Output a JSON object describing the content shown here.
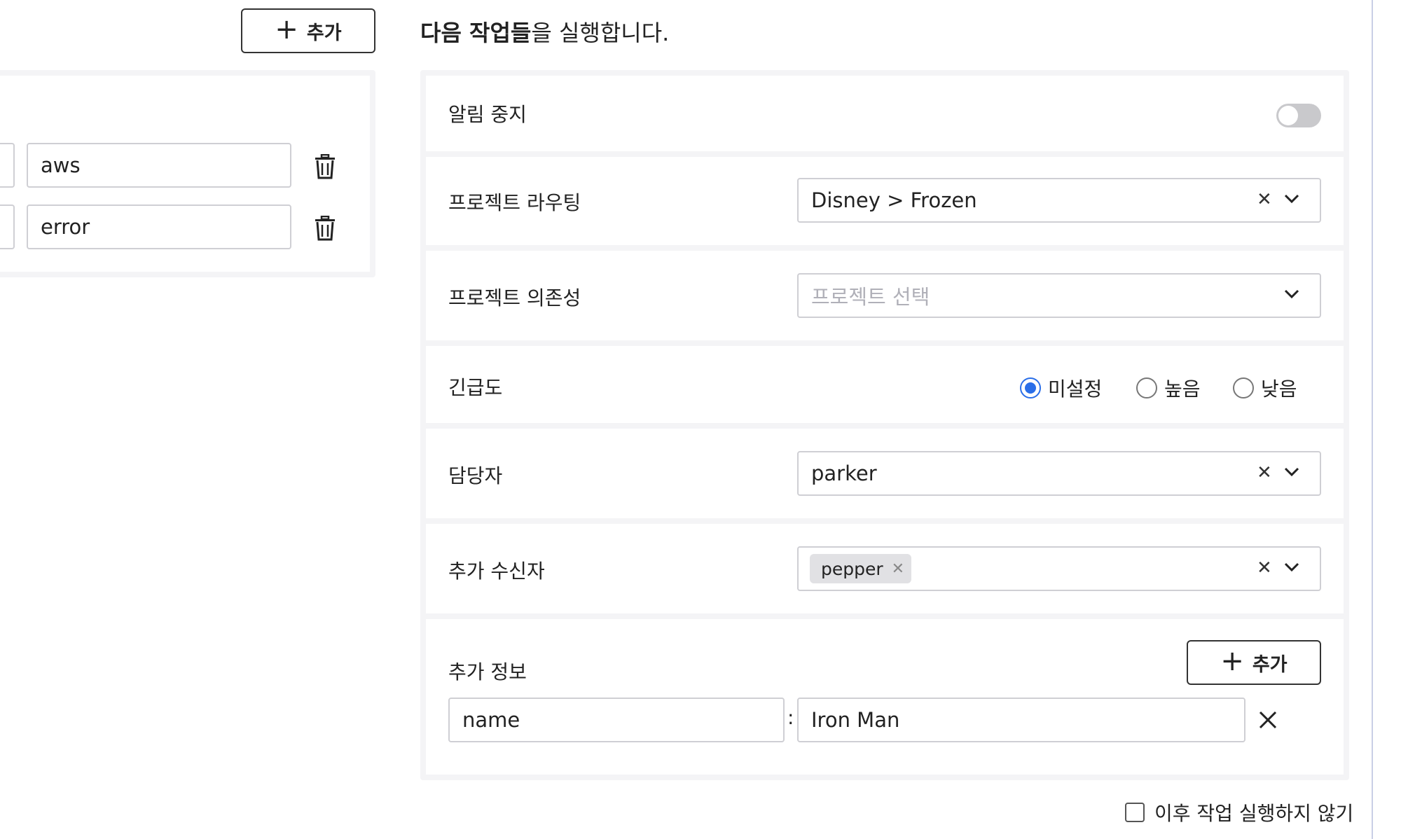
{
  "left": {
    "add_button_label": "추가",
    "conditions": [
      {
        "value": "aws"
      },
      {
        "value": "error"
      }
    ]
  },
  "right": {
    "heading_bold": "다음 작업들",
    "heading_rest": "을 실행합니다.",
    "mute_alerts": {
      "label": "알림 중지",
      "enabled": false
    },
    "project_routing": {
      "label": "프로젝트 라우팅",
      "value": "Disney > Frozen"
    },
    "project_dependency": {
      "label": "프로젝트 의존성",
      "placeholder": "프로젝트 선택"
    },
    "urgency": {
      "label": "긴급도",
      "options": [
        "미설정",
        "높음",
        "낮음"
      ],
      "selected": "미설정"
    },
    "assignee": {
      "label": "담당자",
      "value": "parker"
    },
    "extra_recipients": {
      "label": "추가 수신자",
      "tags": [
        "pepper"
      ]
    },
    "extra_info": {
      "label": "추가 정보",
      "add_button_label": "추가",
      "entries": [
        {
          "key": "name",
          "value": "Iron Man"
        }
      ]
    },
    "stop_subsequent": {
      "label": "이후 작업 실행하지 않기",
      "checked": false
    }
  },
  "colors": {
    "accent": "#2a6ee8",
    "border": "#cfcfd4",
    "panel_bg": "#f4f4f6"
  }
}
